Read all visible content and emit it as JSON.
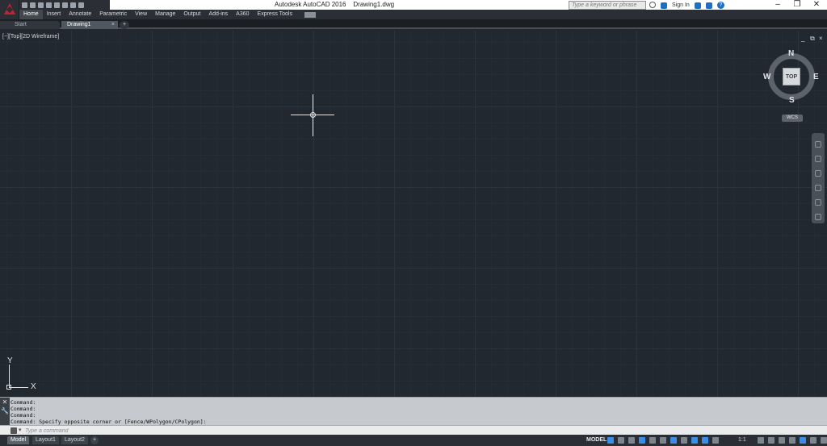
{
  "window": {
    "title": "Autodesk AutoCAD 2016    Drawing1.dwg",
    "search_placeholder": "Type a keyword or phrase",
    "sign_in": "Sign In",
    "help": "?"
  },
  "ribbon_tabs": [
    "Home",
    "Insert",
    "Annotate",
    "Parametric",
    "View",
    "Manage",
    "Output",
    "Add-ins",
    "A360",
    "Express Tools"
  ],
  "file_tabs": {
    "start": "Start",
    "active": "Drawing1",
    "close": "×",
    "add": "+"
  },
  "viewport": {
    "label": "[−][Top][2D Wireframe]",
    "controls": [
      "_",
      "⧉",
      "×"
    ]
  },
  "viewcube": {
    "top": "TOP",
    "north": "N",
    "south": "S",
    "east": "E",
    "west": "W",
    "wcs": "WCS"
  },
  "ucs_icon": {
    "x": "X",
    "y": "Y"
  },
  "command_line": {
    "history": [
      "Command:",
      "Command:",
      "Command:",
      "Command: Specify opposite corner or [Fence/WPolygon/CPolygon]:"
    ],
    "placeholder": "Type a command"
  },
  "layout_tabs": [
    "Model",
    "Layout1",
    "Layout2",
    "+"
  ],
  "status": {
    "model": "MODEL",
    "scale": "1:1"
  }
}
